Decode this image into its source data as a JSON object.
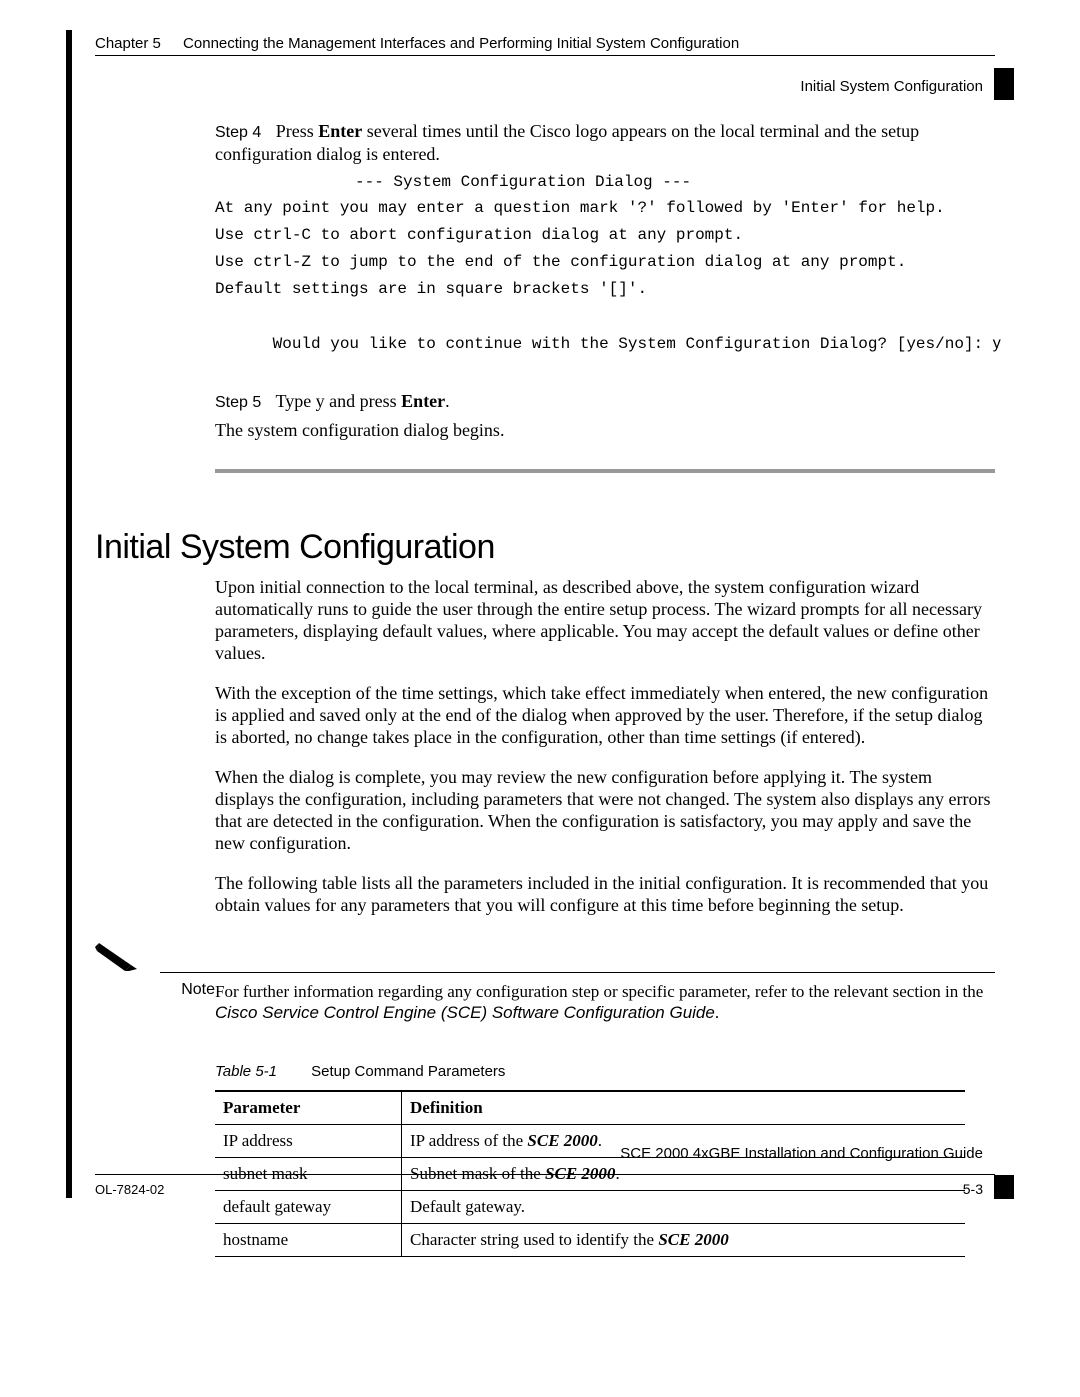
{
  "header": {
    "chapter_label": "Chapter 5",
    "chapter_title": "Connecting the Management Interfaces and Performing Initial System Configuration",
    "section_label": "Initial System Configuration"
  },
  "step4": {
    "label": "Step 4",
    "text_pre": "Press ",
    "enter": "Enter",
    "text_post": " several times until the Cisco logo appears on the local terminal and the setup configuration dialog is entered."
  },
  "mono": {
    "title": "--- System Configuration Dialog ---",
    "l1": "At any point you may enter a question mark '?' followed by 'Enter' for help.",
    "l2": "Use ctrl-C to abort configuration dialog at any prompt.",
    "l3": "Use ctrl-Z to jump to the end of the configuration dialog at any prompt.",
    "l4": "Default settings are in square brackets '[]'.",
    "prompt": "Would you like to continue with the System Configuration Dialog? [yes/no]: ",
    "answer": "y"
  },
  "step5": {
    "label": "Step 5",
    "text_pre": "Type y and press ",
    "enter": "Enter",
    "text_post": "."
  },
  "after_step5": "The system configuration dialog begins.",
  "h1": "Initial System Configuration",
  "p1": "Upon initial connection to the local terminal, as described above, the system configuration wizard automatically runs to guide the user through the entire setup process. The wizard prompts for all necessary parameters, displaying default values, where applicable. You may accept the default values or define other values.",
  "p2": "With the exception of the time settings, which take effect immediately when entered, the new configuration is applied and saved only at the end of the dialog when approved by the user. Therefore, if the setup dialog is aborted, no change takes place in the configuration, other than time settings (if entered).",
  "p3": "When the dialog is complete, you may review the new configuration before applying it. The system displays the configuration, including parameters that were not changed. The system also displays any errors that are detected in the configuration. When the configuration is satisfactory, you may apply and save the new configuration.",
  "p4": "The following table lists all the parameters included in the initial configuration. It is recommended that you obtain values for any parameters that you will configure at this time before beginning the setup.",
  "note": {
    "label": "Note",
    "text_pre": "For further information regarding any configuration step or specific parameter, refer to the relevant section in the ",
    "italic": "Cisco Service Control Engine (SCE) Software Configuration Guide",
    "text_post": "."
  },
  "table": {
    "caption_label": "Table 5-1",
    "caption_title": "Setup Command Parameters",
    "h_param": "Parameter",
    "h_def": "Definition",
    "rows": [
      {
        "param": "IP address",
        "def_pre": "IP address of the ",
        "def_em": "SCE 2000",
        "def_post": "."
      },
      {
        "param": "subnet mask",
        "def_pre": "Subnet mask of the ",
        "def_em": "SCE 2000",
        "def_post": "."
      },
      {
        "param": "default gateway",
        "def_pre": "Default gateway.",
        "def_em": "",
        "def_post": ""
      },
      {
        "param": "hostname",
        "def_pre": "Character string used to identify the ",
        "def_em": "SCE 2000",
        "def_post": ""
      }
    ]
  },
  "footer": {
    "guide": "SCE 2000 4xGBE Installation and Configuration Guide",
    "doc_id": "OL-7824-02",
    "page": "5-3"
  }
}
